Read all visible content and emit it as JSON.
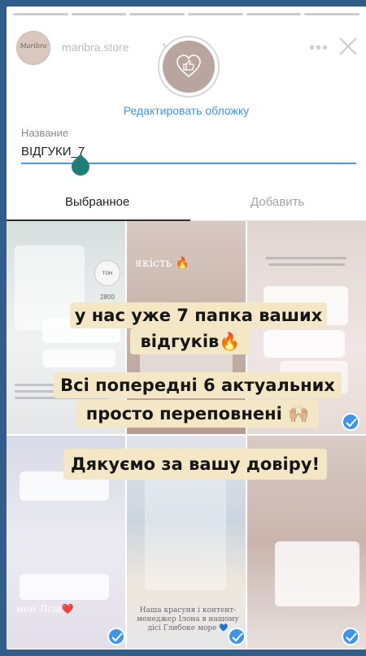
{
  "story": {
    "username": "maribra.store",
    "time": "19ч.",
    "avatar_text": "Maribra",
    "more_label": "•••",
    "progress_segments": 6
  },
  "highlight": {
    "edit_cover_label": "Редактировать обложку",
    "name_label": "Название",
    "name_value": "ВІДГУКИ_7"
  },
  "tabs": {
    "selected_label": "Выбранное",
    "add_label": "Добавить"
  },
  "tiles": {
    "t1_price": "тон 2800",
    "t2_caption": "якість 🔥",
    "t4_caption": "мон Ліза❤️",
    "t5_caption": "Наша красуня і контент-менеджер Ілона в нашому дісі Глибоке море 💙"
  },
  "overlay": {
    "line1": "у нас уже 7 папка ваших",
    "line2": "відгуків🔥",
    "line3": "Всі попередні 6 актуальних",
    "line4": "просто переповнені 🙌🏼",
    "line5": "Дякуємо за вашу довіру!"
  },
  "colors": {
    "accent": "#3f95e6",
    "overlay_bg": "#f4e7c6",
    "cursor": "#1f7f76"
  }
}
